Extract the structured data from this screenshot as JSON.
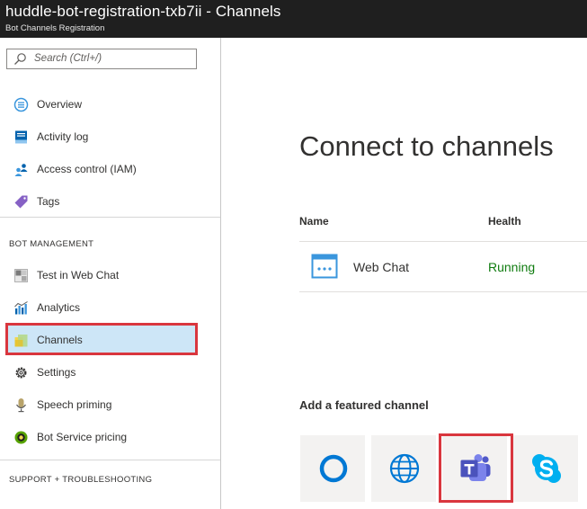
{
  "window": {
    "title": "huddle-bot-registration-txb7ii - Channels",
    "subtitle": "Bot Channels Registration"
  },
  "sidebar": {
    "search": {
      "placeholder": "Search (Ctrl+/)"
    },
    "items": [
      {
        "label": "Overview",
        "icon": "overview-icon"
      },
      {
        "label": "Activity log",
        "icon": "activity-log-icon"
      },
      {
        "label": "Access control (IAM)",
        "icon": "access-control-icon"
      },
      {
        "label": "Tags",
        "icon": "tag-icon"
      }
    ],
    "bot_management": {
      "header": "BOT MANAGEMENT",
      "items": [
        {
          "label": "Test in Web Chat",
          "icon": "test-web-chat-icon"
        },
        {
          "label": "Analytics",
          "icon": "analytics-icon"
        },
        {
          "label": "Channels",
          "icon": "channels-icon",
          "selected": true
        },
        {
          "label": "Settings",
          "icon": "gear-icon"
        },
        {
          "label": "Speech priming",
          "icon": "speech-priming-icon"
        },
        {
          "label": "Bot Service pricing",
          "icon": "pricing-icon"
        }
      ]
    },
    "support": {
      "header": "SUPPORT + TROUBLESHOOTING"
    }
  },
  "main": {
    "heading": "Connect to channels",
    "table": {
      "columns": [
        "Name",
        "Health"
      ],
      "rows": [
        {
          "name": "Web Chat",
          "health": "Running",
          "icon": "web-chat-icon"
        }
      ]
    },
    "featured": {
      "header": "Add a featured channel",
      "channels": [
        {
          "icon": "cortana-icon"
        },
        {
          "icon": "globe-icon"
        },
        {
          "icon": "teams-icon",
          "highlighted": true
        },
        {
          "icon": "skype-icon"
        }
      ]
    }
  },
  "colors": {
    "titlebar_bg": "#1f1f1f",
    "selected_bg": "#cde6f7",
    "highlight_border": "#d9363e",
    "running_green": "#107c10",
    "azure_blue": "#0078d4"
  }
}
